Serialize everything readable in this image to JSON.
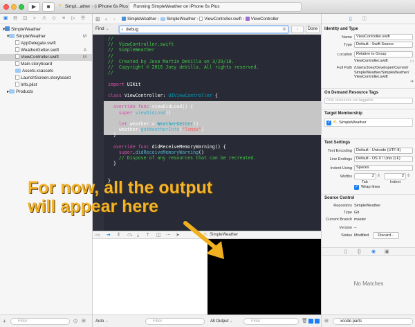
{
  "toolbar": {
    "scheme_app": "Simpl...ather",
    "scheme_device": "iPhone 6s Plus",
    "activity": "Running SimpleWeather on iPhone 6s Plus"
  },
  "navigator": {
    "items": [
      {
        "label": "SimpleWeather",
        "badge": "",
        "kind": "project"
      },
      {
        "label": "SimpleWeather",
        "badge": "M",
        "kind": "folder"
      },
      {
        "label": "AppDelegate.swift",
        "badge": "",
        "kind": "file"
      },
      {
        "label": "WeatherGetter.swift",
        "badge": "A",
        "kind": "file"
      },
      {
        "label": "ViewController.swift",
        "badge": "M",
        "kind": "file"
      },
      {
        "label": "Main.storyboard",
        "badge": "",
        "kind": "file"
      },
      {
        "label": "Assets.xcassets",
        "badge": "",
        "kind": "folder"
      },
      {
        "label": "LaunchScreen.storyboard",
        "badge": "",
        "kind": "file"
      },
      {
        "label": "Info.plist",
        "badge": "",
        "kind": "file"
      },
      {
        "label": "Products",
        "badge": "",
        "kind": "folder"
      }
    ],
    "filter_placeholder": "Filter"
  },
  "jumpbar": {
    "crumbs": [
      "SimpleWeather",
      "SimpleWeather",
      "ViewController.swift",
      "ViewController"
    ]
  },
  "find": {
    "label": "Find",
    "query": "debug",
    "done": "Done"
  },
  "code": {
    "lines": [
      [
        {
          "t": "//",
          "c": "com"
        }
      ],
      [
        {
          "t": "//  ViewController.swift",
          "c": "com"
        }
      ],
      [
        {
          "t": "//  SimpleWeather",
          "c": "com"
        }
      ],
      [
        {
          "t": "//",
          "c": "com"
        }
      ],
      [
        {
          "t": "//  Created by Jose Martin DeVilla on 3/29/18.",
          "c": "com"
        }
      ],
      [
        {
          "t": "//  Copyright © 2016 Joey deVilla. All rights reserved.",
          "c": "com"
        }
      ],
      [
        {
          "t": "//",
          "c": "com"
        }
      ],
      [
        {
          "t": "",
          "c": "plain"
        }
      ],
      [
        {
          "t": "import",
          "c": "kw"
        },
        {
          "t": " UIKit",
          "c": "plain"
        }
      ],
      [
        {
          "t": "",
          "c": "plain"
        }
      ],
      [
        {
          "t": "class",
          "c": "kw"
        },
        {
          "t": " ViewController: ",
          "c": "plain"
        },
        {
          "t": "UIViewController",
          "c": "type"
        },
        {
          "t": " {",
          "c": "plain"
        }
      ],
      [
        {
          "t": "",
          "c": "plain"
        }
      ],
      [
        {
          "t": "  ",
          "c": "plain"
        },
        {
          "t": "override",
          "c": "kw"
        },
        {
          "t": " ",
          "c": "plain"
        },
        {
          "t": "func",
          "c": "kw"
        },
        {
          "t": " viewDidLoad() {",
          "c": "plain"
        }
      ],
      [
        {
          "t": "    ",
          "c": "plain"
        },
        {
          "t": "super",
          "c": "kw"
        },
        {
          "t": ".",
          "c": "plain"
        },
        {
          "t": "viewDidLoad",
          "c": "fn"
        },
        {
          "t": "()",
          "c": "plain"
        }
      ],
      [
        {
          "t": "",
          "c": "plain"
        }
      ],
      [
        {
          "t": "    ",
          "c": "plain"
        },
        {
          "t": "let",
          "c": "kw"
        },
        {
          "t": " weather = ",
          "c": "plain"
        },
        {
          "t": "WeatherGetter",
          "c": "type"
        },
        {
          "t": "()",
          "c": "plain"
        }
      ],
      [
        {
          "t": "    weather.",
          "c": "plain"
        },
        {
          "t": "getWeatherInfo",
          "c": "fn"
        },
        {
          "t": "(",
          "c": "plain"
        },
        {
          "t": "\"Tampa\"",
          "c": "str"
        },
        {
          "t": ")",
          "c": "plain"
        }
      ],
      [
        {
          "t": "  }",
          "c": "plain"
        }
      ],
      [
        {
          "t": "",
          "c": "plain"
        }
      ],
      [
        {
          "t": "  ",
          "c": "plain"
        },
        {
          "t": "override",
          "c": "kw"
        },
        {
          "t": " ",
          "c": "plain"
        },
        {
          "t": "func",
          "c": "kw"
        },
        {
          "t": " didReceiveMemoryWarning() {",
          "c": "plain"
        }
      ],
      [
        {
          "t": "    ",
          "c": "plain"
        },
        {
          "t": "super",
          "c": "kw"
        },
        {
          "t": ".",
          "c": "plain"
        },
        {
          "t": "didReceiveMemoryWarning",
          "c": "fn"
        },
        {
          "t": "()",
          "c": "plain"
        }
      ],
      [
        {
          "t": "    // Dispose of any resources that can be recreated.",
          "c": "com"
        }
      ],
      [
        {
          "t": "  }",
          "c": "plain"
        }
      ],
      [
        {
          "t": "",
          "c": "plain"
        }
      ],
      [
        {
          "t": "",
          "c": "plain"
        }
      ],
      [
        {
          "t": "}",
          "c": "plain"
        }
      ]
    ]
  },
  "debug": {
    "target": "SimpleWeather",
    "vars_mode": "Auto",
    "vars_filter": "Filter",
    "console_mode": "All Output",
    "console_filter": "Filter"
  },
  "inspector": {
    "identity_title": "Identity and Type",
    "name_label": "Name",
    "name_value": "ViewController.swift",
    "type_label": "Type",
    "type_value": "Default - Swift Source",
    "location_label": "Location",
    "location_value": "Relative to Group",
    "location_file": "ViewController.swift",
    "fullpath_label": "Full Path",
    "fullpath_value": "/Users/Joey/Developer/Current/SimpleWeather/SimpleWeather/ViewController.swift",
    "odr_title": "On Demand Resource Tags",
    "odr_placeholder": "Only resources are taggable",
    "membership_title": "Target Membership",
    "membership_item": "SimpleWeather",
    "text_title": "Text Settings",
    "encoding_label": "Text Encoding",
    "encoding_value": "Default - Unicode (UTF-8)",
    "endings_label": "Line Endings",
    "endings_value": "Default - OS X / Unix (LF)",
    "indent_label": "Indent Using",
    "indent_value": "Spaces",
    "widths_label": "Widths",
    "tab_value": "2",
    "indent_width_value": "2",
    "tab_label": "Tab",
    "indent_sub_label": "Indent",
    "wrap_label": "Wrap lines",
    "source_title": "Source Control",
    "repo_label": "Repository",
    "repo_value": "SimpleWeather",
    "sc_type_label": "Type",
    "sc_type_value": "Git",
    "branch_label": "Current Branch",
    "branch_value": "master",
    "version_label": "Version",
    "version_value": "--",
    "status_label": "Status",
    "status_value": "Modified",
    "discard_label": "Discard..."
  },
  "library": {
    "empty_text": "No Matches",
    "filter_value": "xcode parts"
  },
  "overlay": {
    "line1": "For now, all the output",
    "line2": "will appear here"
  },
  "colors": {
    "editor_bg": "#282b35",
    "overlay_text": "#f3b32a",
    "arrow": "#f0b020",
    "selection": "#c6c6c6"
  }
}
